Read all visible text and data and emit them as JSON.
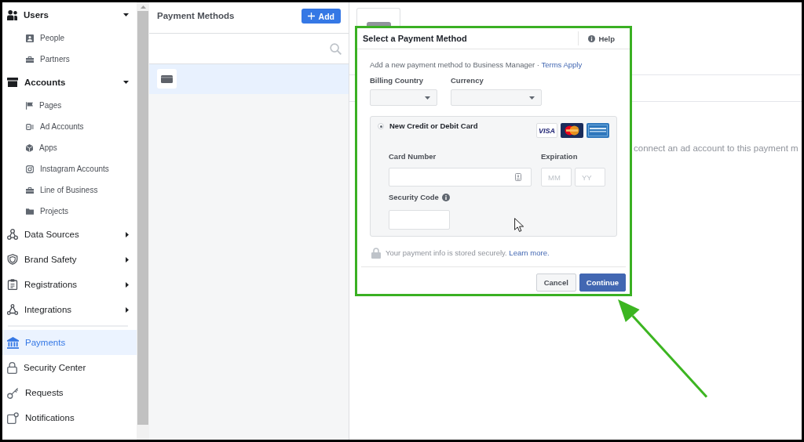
{
  "sidebar": {
    "sections": [
      {
        "label": "Users",
        "expanded": true,
        "children": [
          {
            "label": "People"
          },
          {
            "label": "Partners"
          }
        ]
      },
      {
        "label": "Accounts",
        "expanded": true,
        "children": [
          {
            "label": "Pages"
          },
          {
            "label": "Ad Accounts"
          },
          {
            "label": "Apps"
          },
          {
            "label": "Instagram Accounts"
          },
          {
            "label": "Line of Business"
          },
          {
            "label": "Projects"
          }
        ]
      },
      {
        "label": "Data Sources",
        "expanded": false
      },
      {
        "label": "Brand Safety",
        "expanded": false
      },
      {
        "label": "Registrations",
        "expanded": false
      },
      {
        "label": "Integrations",
        "expanded": false
      }
    ],
    "links": [
      {
        "label": "Payments",
        "selected": true
      },
      {
        "label": "Security Center",
        "selected": false
      },
      {
        "label": "Requests",
        "selected": false
      },
      {
        "label": "Notifications",
        "selected": false
      }
    ]
  },
  "payment_methods": {
    "title": "Payment Methods",
    "add_button": "Add",
    "items": [
      {
        "selected": true
      }
    ]
  },
  "details": {
    "message": "connect an ad account to this payment m"
  },
  "dialog": {
    "title": "Select a Payment Method",
    "help": "Help",
    "intro": "Add a new payment method to Business Manager ·",
    "terms_link": "Terms Apply",
    "billing_country": {
      "label": "Billing Country"
    },
    "currency": {
      "label": "Currency"
    },
    "payment_options": [
      {
        "label": "New Credit or Debit Card",
        "selected": true
      }
    ],
    "card_brands": [
      {
        "kind": "visa",
        "label": "VISA"
      },
      {
        "kind": "mastercard"
      },
      {
        "kind": "amex"
      }
    ],
    "card_number": {
      "label": "Card Number"
    },
    "expiration": {
      "label": "Expiration",
      "month": {
        "placeholder": "MM"
      },
      "year": {
        "placeholder": "YY"
      }
    },
    "security_code": {
      "label": "Security Code"
    },
    "secure_note": "Your payment info is stored securely.",
    "learn_more_link": "Learn more.",
    "buttons": [
      {
        "label": "Cancel",
        "kind": "secondary"
      },
      {
        "label": "Continue",
        "kind": "primary"
      }
    ]
  }
}
